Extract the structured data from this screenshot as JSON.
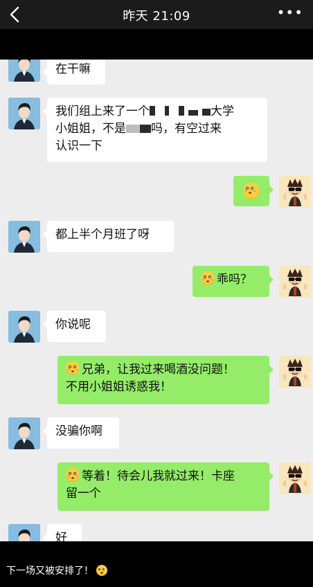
{
  "header": {
    "back_icon": "chevron-left-icon",
    "title": "昨天 21:09",
    "more_icon": "more-dots-icon",
    "more_text": "•••"
  },
  "messages": [
    {
      "side": "left",
      "text": "在干嘛"
    },
    {
      "side": "left",
      "text_parts": [
        "我们组上来了一个",
        "大学",
        "小姐姐，不是",
        "吗，有空过来",
        "认识一下"
      ]
    },
    {
      "side": "right",
      "emoji": "flushed-face-emoji"
    },
    {
      "side": "left",
      "text": "都上半个月班了呀"
    },
    {
      "side": "right",
      "text": "乖吗？"
    },
    {
      "side": "left",
      "text": "你说呢"
    },
    {
      "side": "right",
      "text_line1": "兄弟，让我过来喝酒没问题！",
      "text_line2": "不用小姐姐诱惑我！"
    },
    {
      "side": "left",
      "text": "没骗你啊"
    },
    {
      "side": "right",
      "text_line1": "等着！待会儿我就过来！卡座",
      "text_line2": "留一个"
    },
    {
      "side": "left",
      "text": "好"
    }
  ],
  "caption": {
    "text": "下一场又被安排了！"
  },
  "colors": {
    "chat_bg": "#ededed",
    "sent_bubble": "#95ec69",
    "received_bubble": "#ffffff",
    "topbar": "#1b1b1b"
  }
}
